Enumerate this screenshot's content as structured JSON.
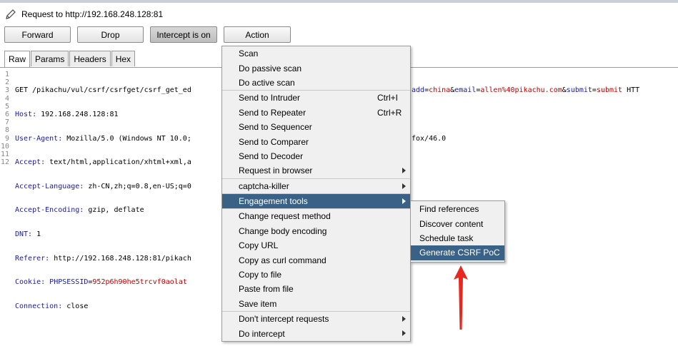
{
  "request_title": "Request to http://192.168.248.128:81",
  "toolbar": {
    "forward": "Forward",
    "drop": "Drop",
    "intercept": "Intercept is on",
    "action": "Action"
  },
  "tabs": [
    "Raw",
    "Params",
    "Headers",
    "Hex"
  ],
  "gutter": [
    "1",
    "2",
    "3",
    "4",
    "5",
    "6",
    "7",
    "8",
    "9",
    "10",
    "11",
    "12"
  ],
  "request_lines": {
    "l1": "GET /pikachu/vul/csrf/csrfget/csrf_get_ed",
    "l2k": "Host:",
    "l2v": " 192.168.248.128:81",
    "l3k": "User-Agent:",
    "l3v": " Mozilla/5.0 (Windows NT 10.0;",
    "l4k": "Accept:",
    "l4v": " text/html,application/xhtml+xml,a",
    "l5k": "Accept-Language:",
    "l5v": " zh-CN,zh;q=0.8,en-US;q=0",
    "l6k": "Accept-Encoding:",
    "l6v": " gzip, deflate",
    "l7k": "DNT:",
    "l7v": " 1",
    "l8k": "Referer:",
    "l8v": " http://192.168.248.128:81/pikach",
    "l9k": "Cookie:",
    "l9a": " PHPSESSID",
    "l9b": "=",
    "l9c": "952p6h90he5trcvf0aolat",
    "l10k": "Connection:",
    "l10v": " close"
  },
  "request_right": {
    "p1": "add",
    "p2": "=",
    "p3": "china",
    "p4": "&",
    "p5": "email",
    "p6": "=",
    "p7": "allen%40pikachu.com",
    "p8": "&",
    "p9": "submit",
    "p10": "=",
    "p11": "submit",
    "p12": " HTT",
    "l3": "fox/46.0"
  },
  "context_menu": {
    "items": [
      {
        "label": "Scan"
      },
      {
        "label": "Do passive scan"
      },
      {
        "label": "Do active scan"
      },
      {
        "label": "Send to Intruder",
        "shortcut": "Ctrl+I"
      },
      {
        "label": "Send to Repeater",
        "shortcut": "Ctrl+R"
      },
      {
        "label": "Send to Sequencer"
      },
      {
        "label": "Send to Comparer"
      },
      {
        "label": "Send to Decoder"
      },
      {
        "label": "Request in browser"
      },
      {
        "label": "captcha-killer"
      },
      {
        "label": "Engagement tools"
      },
      {
        "label": "Change request method"
      },
      {
        "label": "Change body encoding"
      },
      {
        "label": "Copy URL"
      },
      {
        "label": "Copy as curl command"
      },
      {
        "label": "Copy to file"
      },
      {
        "label": "Paste from file"
      },
      {
        "label": "Save item"
      },
      {
        "label": "Don't intercept requests"
      },
      {
        "label": "Do intercept"
      }
    ]
  },
  "submenu": {
    "items": [
      {
        "label": "Find references"
      },
      {
        "label": "Discover content"
      },
      {
        "label": "Schedule task"
      },
      {
        "label": "Generate CSRF PoC"
      }
    ]
  },
  "colors": {
    "selection": "#3a6286",
    "header_key": "#1a1aa6",
    "param_value": "#c00000",
    "annotation_arrow": "#e8271e"
  }
}
